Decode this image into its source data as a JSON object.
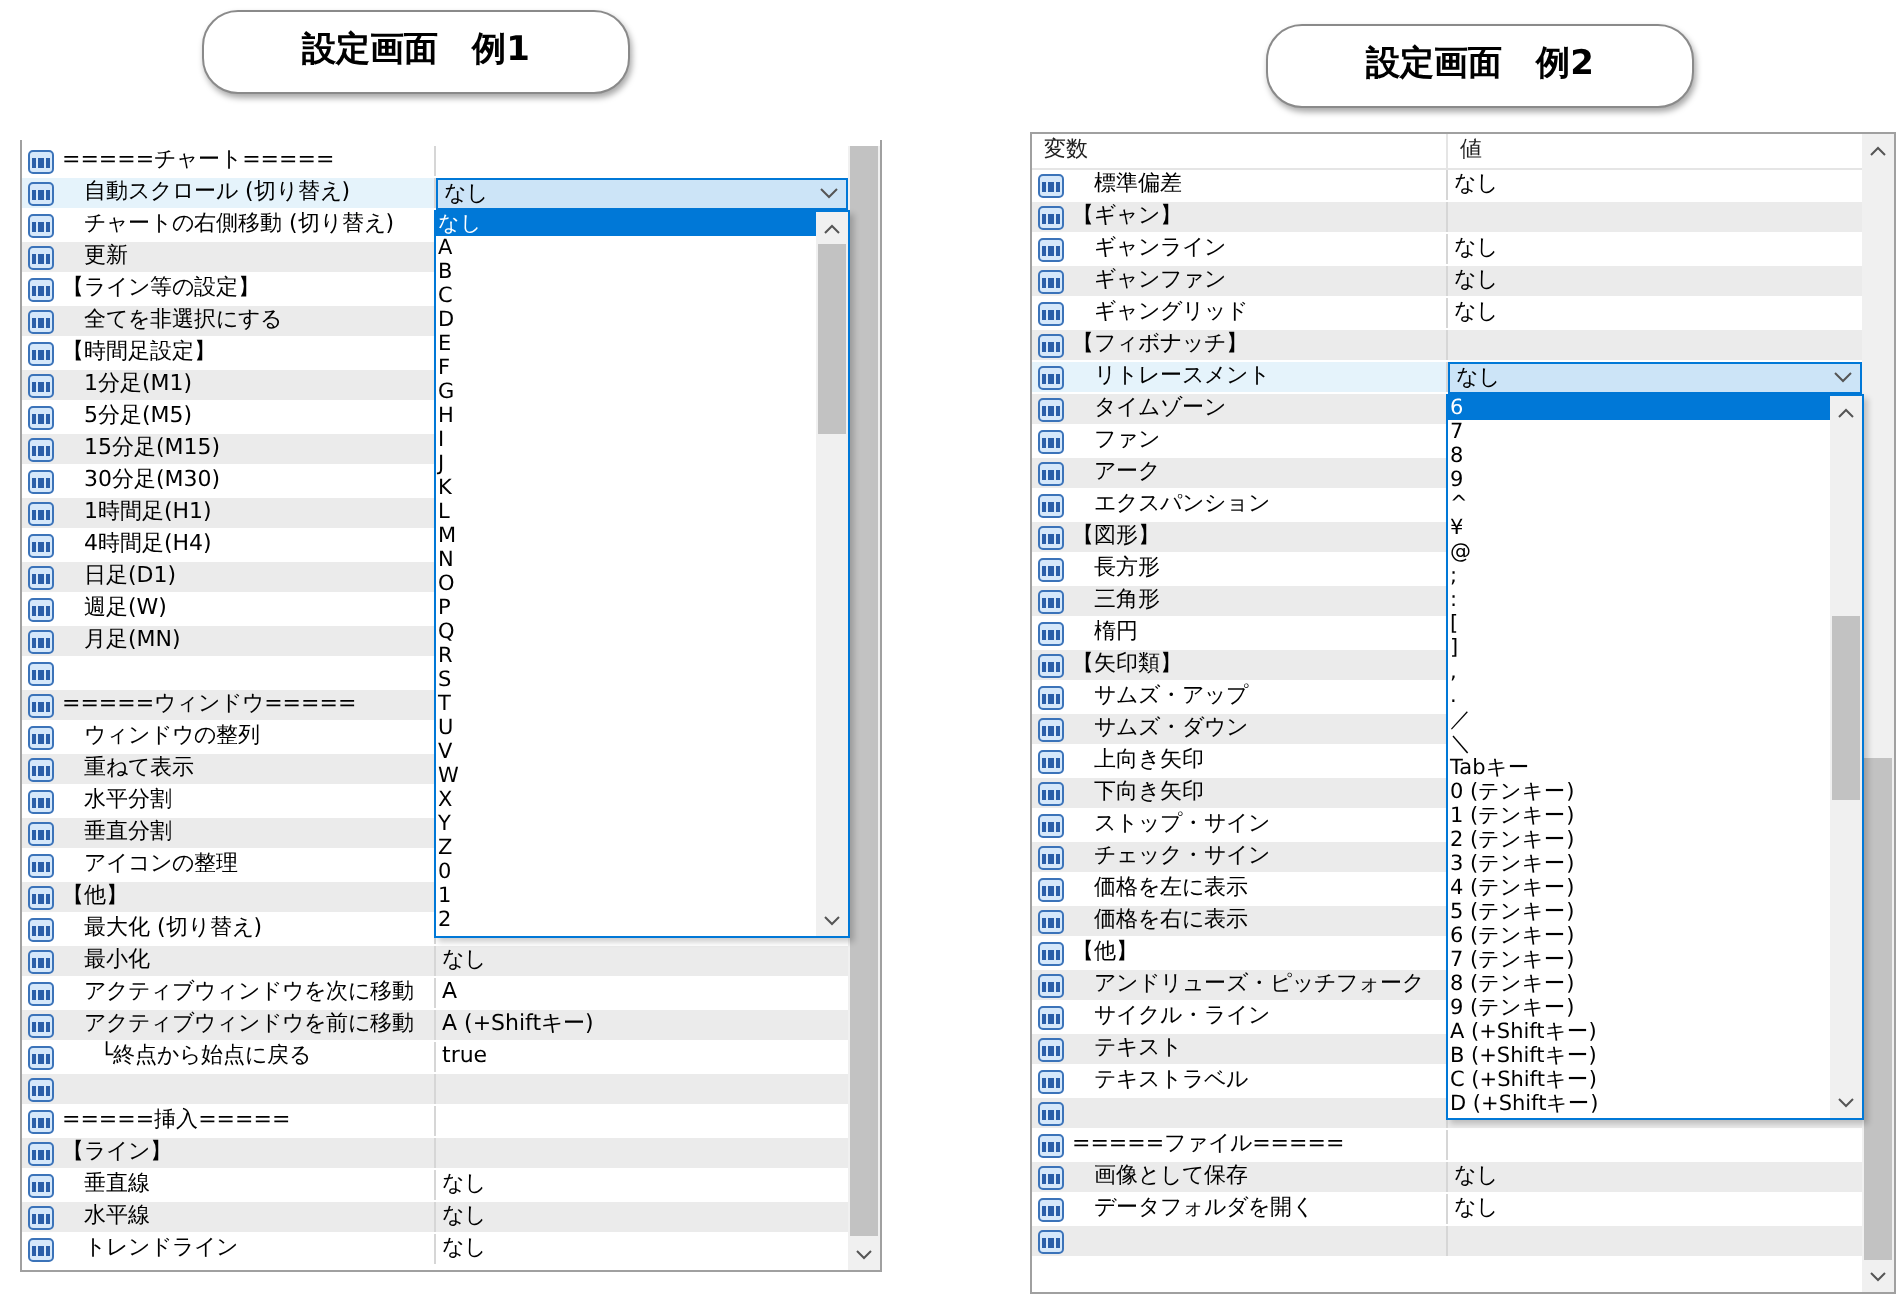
{
  "panels": [
    {
      "title": "設定画面　例1",
      "rows": [
        {
          "kind": "section",
          "name": "=====チャート=====",
          "selected": false
        },
        {
          "kind": "setting",
          "name": "自動スクロール (切り替え)",
          "value": "なし",
          "selected": true
        },
        {
          "kind": "setting",
          "name": "チャートの右側移動 (切り替え)",
          "selected": false
        },
        {
          "kind": "setting",
          "name": "更新",
          "selected": false
        },
        {
          "kind": "section",
          "name": "【ライン等の設定】",
          "selected": false
        },
        {
          "kind": "setting",
          "name": "全てを非選択にする",
          "selected": false
        },
        {
          "kind": "section",
          "name": "【時間足設定】",
          "selected": false
        },
        {
          "kind": "setting",
          "name": "1分足(M1)",
          "selected": false
        },
        {
          "kind": "setting",
          "name": "5分足(M5)",
          "selected": false
        },
        {
          "kind": "setting",
          "name": "15分足(M15)",
          "selected": false
        },
        {
          "kind": "setting",
          "name": "30分足(M30)",
          "selected": false
        },
        {
          "kind": "setting",
          "name": "1時間足(H1)",
          "selected": false
        },
        {
          "kind": "setting",
          "name": "4時間足(H4)",
          "selected": false
        },
        {
          "kind": "setting",
          "name": "日足(D1)",
          "selected": false
        },
        {
          "kind": "setting",
          "name": "週足(W)",
          "selected": false
        },
        {
          "kind": "setting",
          "name": "月足(MN)",
          "selected": false
        },
        {
          "kind": "blank",
          "selected": false
        },
        {
          "kind": "section",
          "name": "=====ウィンドウ=====",
          "selected": false
        },
        {
          "kind": "setting",
          "name": "ウィンドウの整列",
          "selected": false
        },
        {
          "kind": "setting",
          "name": "重ねて表示",
          "selected": false
        },
        {
          "kind": "setting",
          "name": "水平分割",
          "selected": false
        },
        {
          "kind": "setting",
          "name": "垂直分割",
          "selected": false
        },
        {
          "kind": "setting",
          "name": "アイコンの整理",
          "selected": false
        },
        {
          "kind": "section",
          "name": "【他】",
          "selected": false
        },
        {
          "kind": "setting",
          "name": "最大化 (切り替え)",
          "selected": false
        },
        {
          "kind": "setting",
          "name": "最小化",
          "value": "なし",
          "selected": false
        },
        {
          "kind": "setting",
          "name": "アクティブウィンドウを次に移動",
          "value": "A",
          "selected": false
        },
        {
          "kind": "setting",
          "name": "アクティブウィンドウを前に移動",
          "value": "A (+Shiftキー)",
          "selected": false,
          "children": [
            {
              "kind": "setting",
              "name": "└終点から始点に戻る",
              "value": "true",
              "selected": false
            }
          ]
        },
        {
          "kind": "blank",
          "selected": false
        },
        {
          "kind": "section",
          "name": "=====挿入=====",
          "selected": false
        },
        {
          "kind": "section",
          "name": "【ライン】",
          "selected": false
        },
        {
          "kind": "setting",
          "name": "垂直線",
          "value": "なし",
          "selected": false
        },
        {
          "kind": "setting",
          "name": "水平線",
          "value": "なし",
          "selected": false
        },
        {
          "kind": "setting",
          "name": "トレンドライン",
          "value": "なし",
          "selected": false
        }
      ],
      "dropdown": {
        "options": [
          {
            "label": "なし",
            "selected": true
          },
          {
            "label": "A",
            "selected": false
          },
          {
            "label": "B",
            "selected": false
          },
          {
            "label": "C",
            "selected": false
          },
          {
            "label": "D",
            "selected": false
          },
          {
            "label": "E",
            "selected": false
          },
          {
            "label": "F",
            "selected": false
          },
          {
            "label": "G",
            "selected": false
          },
          {
            "label": "H",
            "selected": false
          },
          {
            "label": "I",
            "selected": false
          },
          {
            "label": "J",
            "selected": false
          },
          {
            "label": "K",
            "selected": false
          },
          {
            "label": "L",
            "selected": false
          },
          {
            "label": "M",
            "selected": false
          },
          {
            "label": "N",
            "selected": false
          },
          {
            "label": "O",
            "selected": false
          },
          {
            "label": "P",
            "selected": false
          },
          {
            "label": "Q",
            "selected": false
          },
          {
            "label": "R",
            "selected": false
          },
          {
            "label": "S",
            "selected": false
          },
          {
            "label": "T",
            "selected": false
          },
          {
            "label": "U",
            "selected": false
          },
          {
            "label": "V",
            "selected": false
          },
          {
            "label": "W",
            "selected": false
          },
          {
            "label": "X",
            "selected": false
          },
          {
            "label": "Y",
            "selected": false
          },
          {
            "label": "Z",
            "selected": false
          },
          {
            "label": "0",
            "selected": false
          },
          {
            "label": "1",
            "selected": false
          },
          {
            "label": "2",
            "selected": false
          }
        ]
      }
    },
    {
      "title": "設定画面　例2",
      "columns": [
        "変数",
        "値"
      ],
      "rows": [
        {
          "kind": "setting",
          "name": "標準偏差",
          "value": "なし",
          "selected": false
        },
        {
          "kind": "section",
          "name": "【ギャン】",
          "selected": false
        },
        {
          "kind": "setting",
          "name": "ギャンライン",
          "value": "なし",
          "selected": false
        },
        {
          "kind": "setting",
          "name": "ギャンファン",
          "value": "なし",
          "selected": false
        },
        {
          "kind": "setting",
          "name": "ギャングリッド",
          "value": "なし",
          "selected": false
        },
        {
          "kind": "section",
          "name": "【フィボナッチ】",
          "selected": false
        },
        {
          "kind": "setting",
          "name": "リトレースメント",
          "value": "なし",
          "selected": true
        },
        {
          "kind": "setting",
          "name": "タイムゾーン",
          "selected": false
        },
        {
          "kind": "setting",
          "name": "ファン",
          "selected": false
        },
        {
          "kind": "setting",
          "name": "アーク",
          "selected": false
        },
        {
          "kind": "setting",
          "name": "エクスパンション",
          "selected": false
        },
        {
          "kind": "section",
          "name": "【図形】",
          "selected": false
        },
        {
          "kind": "setting",
          "name": "長方形",
          "selected": false
        },
        {
          "kind": "setting",
          "name": "三角形",
          "selected": false
        },
        {
          "kind": "setting",
          "name": "楕円",
          "selected": false
        },
        {
          "kind": "section",
          "name": "【矢印類】",
          "selected": false
        },
        {
          "kind": "setting",
          "name": "サムズ・アップ",
          "selected": false
        },
        {
          "kind": "setting",
          "name": "サムズ・ダウン",
          "selected": false
        },
        {
          "kind": "setting",
          "name": "上向き矢印",
          "selected": false
        },
        {
          "kind": "setting",
          "name": "下向き矢印",
          "selected": false
        },
        {
          "kind": "setting",
          "name": "ストップ・サイン",
          "selected": false
        },
        {
          "kind": "setting",
          "name": "チェック・サイン",
          "selected": false
        },
        {
          "kind": "setting",
          "name": "価格を左に表示",
          "selected": false
        },
        {
          "kind": "setting",
          "name": "価格を右に表示",
          "selected": false
        },
        {
          "kind": "section",
          "name": "【他】",
          "selected": false
        },
        {
          "kind": "setting",
          "name": "アンドリューズ・ピッチフォーク",
          "selected": false
        },
        {
          "kind": "setting",
          "name": "サイクル・ライン",
          "selected": false
        },
        {
          "kind": "setting",
          "name": "テキスト",
          "selected": false
        },
        {
          "kind": "setting",
          "name": "テキストラベル",
          "selected": false
        },
        {
          "kind": "blank",
          "selected": false
        },
        {
          "kind": "section",
          "name": "=====ファイル=====",
          "selected": false
        },
        {
          "kind": "setting",
          "name": "画像として保存",
          "value": "なし",
          "selected": false
        },
        {
          "kind": "setting",
          "name": "データフォルダを開く",
          "value": "なし",
          "selected": false
        },
        {
          "kind": "blank",
          "selected": false
        }
      ],
      "dropdown": {
        "options": [
          {
            "label": "6",
            "selected": true
          },
          {
            "label": "7",
            "selected": false
          },
          {
            "label": "8",
            "selected": false
          },
          {
            "label": "9",
            "selected": false
          },
          {
            "label": "^",
            "selected": false
          },
          {
            "label": "¥",
            "selected": false
          },
          {
            "label": "@",
            "selected": false
          },
          {
            "label": ";",
            "selected": false
          },
          {
            "label": ":",
            "selected": false
          },
          {
            "label": "[",
            "selected": false
          },
          {
            "label": "]",
            "selected": false
          },
          {
            "label": ",",
            "selected": false
          },
          {
            "label": ".",
            "selected": false
          },
          {
            "label": "／",
            "selected": false
          },
          {
            "label": "＼",
            "selected": false
          },
          {
            "label": "Tabキー",
            "selected": false
          },
          {
            "label": "0 (テンキー)",
            "selected": false
          },
          {
            "label": "1 (テンキー)",
            "selected": false
          },
          {
            "label": "2 (テンキー)",
            "selected": false
          },
          {
            "label": "3 (テンキー)",
            "selected": false
          },
          {
            "label": "4 (テンキー)",
            "selected": false
          },
          {
            "label": "5 (テンキー)",
            "selected": false
          },
          {
            "label": "6 (テンキー)",
            "selected": false
          },
          {
            "label": "7 (テンキー)",
            "selected": false
          },
          {
            "label": "8 (テンキー)",
            "selected": false
          },
          {
            "label": "9 (テンキー)",
            "selected": false
          },
          {
            "label": "A (+Shiftキー)",
            "selected": false
          },
          {
            "label": "B (+Shiftキー)",
            "selected": false
          },
          {
            "label": "C (+Shiftキー)",
            "selected": false
          },
          {
            "label": "D (+Shiftキー)",
            "selected": false
          }
        ]
      }
    }
  ]
}
